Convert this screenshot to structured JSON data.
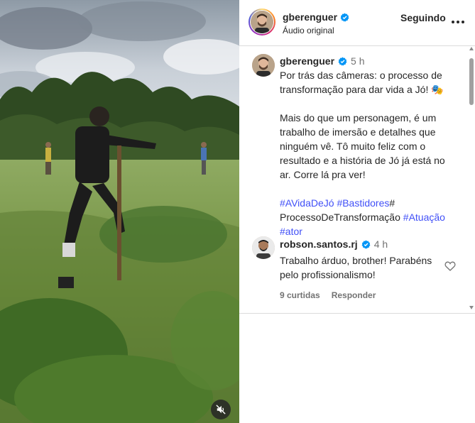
{
  "header": {
    "username": "gberenguer",
    "audio": "Áudio original",
    "follow_label": "Seguindo"
  },
  "caption": {
    "username": "gberenguer",
    "time": "5 h",
    "paragraph1": "Por trás das câmeras: o processo de transformação para dar vida a Jó! 🎭",
    "paragraph2": "Mais do que um personagem, é um trabalho de imersão e detalhes que ninguém vê. Tô muito feliz com o resultado e a história de Jó já está no ar. Corre lá pra ver!",
    "hashtags": {
      "tag1": "#AVidaDeJó",
      "tag2": "#Bastidores",
      "tag3_hash": "#",
      "tag3_text": "ProcessoDeTransformação",
      "tag4": "#Atuação",
      "tag5": "#ator"
    }
  },
  "comment": {
    "username": "robson.santos.rj",
    "time": "4 h",
    "text": "Trabalho árduo, brother! Parabéns pelo profissionalismo!",
    "likes_label": "9 curtidas",
    "reply_label": "Responder"
  },
  "icons": {
    "verified": "verified-badge-icon",
    "more": "more-options-icon",
    "mute": "audio-muted-icon",
    "like": "heart-icon"
  },
  "colors": {
    "verified_blue": "#0095f6",
    "hashtag_blue": "#4150f7",
    "text": "#262626",
    "secondary": "#737373"
  }
}
